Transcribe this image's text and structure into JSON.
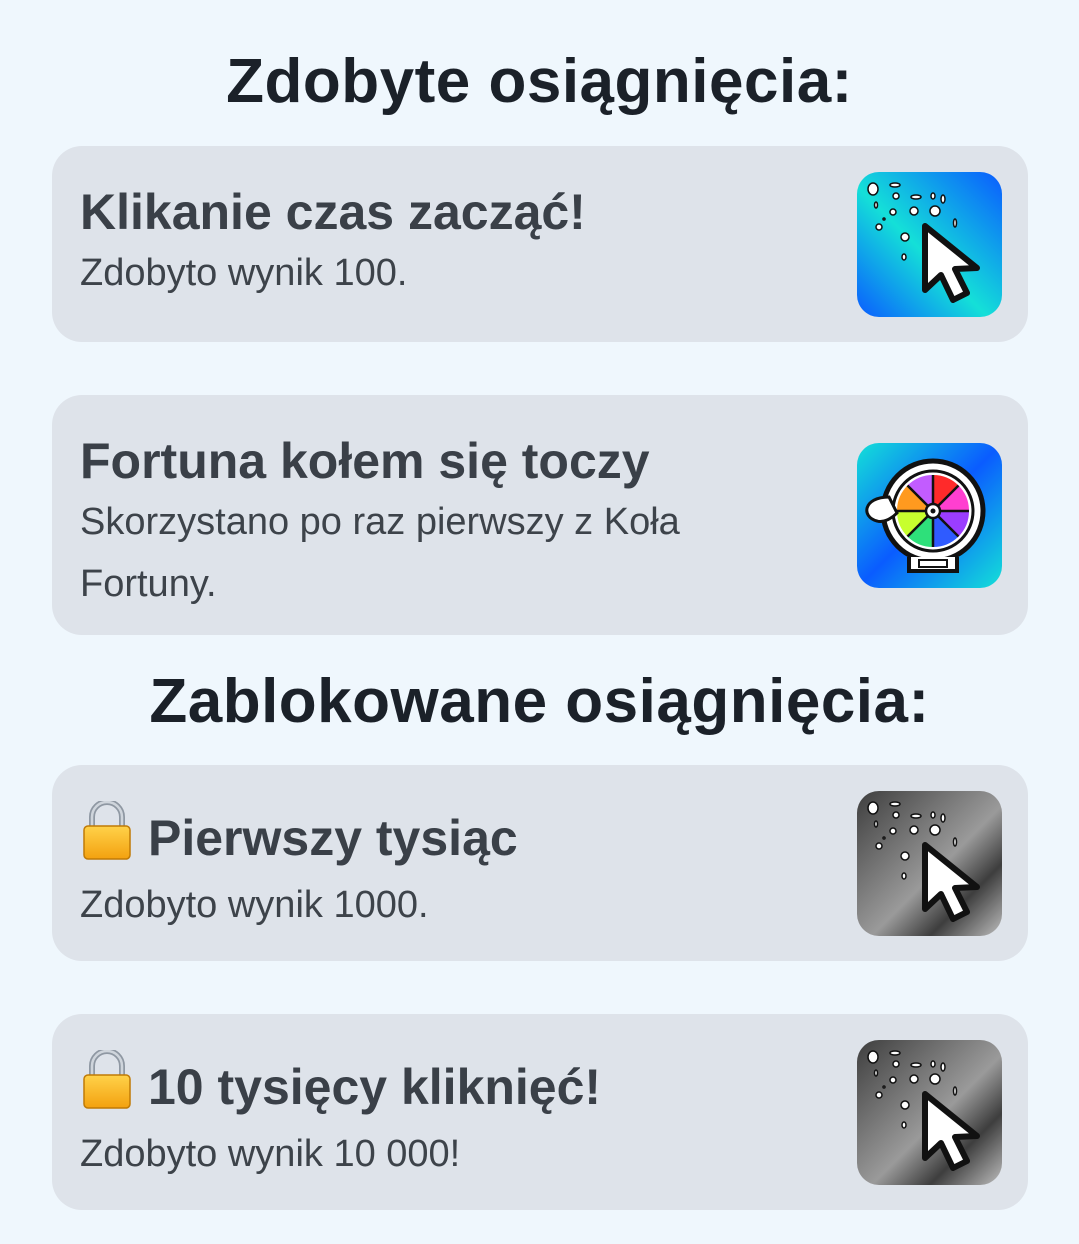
{
  "unlocked_heading": "Zdobyte osiągnięcia:",
  "locked_heading": "Zablokowane osiągnięcia:",
  "unlocked": [
    {
      "title": "Klikanie czas zacząć!",
      "description": "Zdobyto wynik 100.",
      "icon": "cursor-click-icon",
      "colors": [
        "#14e0c8",
        "#0a5cff"
      ]
    },
    {
      "title": "Fortuna kołem się toczy",
      "description": "Skorzystano po raz pierwszy z Koła Fortuny.",
      "icon": "fortune-wheel-icon",
      "colors": [
        "#14e0c8",
        "#0a5cff"
      ]
    }
  ],
  "locked": [
    {
      "title": "Pierwszy tysiąc",
      "description": "Zdobyto wynik 1000.",
      "icon": "cursor-click-icon",
      "lock_icon": "lock-icon",
      "colors": [
        "#cfcfcf",
        "#3e3e3e"
      ]
    },
    {
      "title": "10 tysięcy kliknięć!",
      "description": "Zdobyto wynik 10 000!",
      "icon": "cursor-click-icon",
      "lock_icon": "lock-icon",
      "colors": [
        "#cfcfcf",
        "#3e3e3e"
      ]
    }
  ]
}
